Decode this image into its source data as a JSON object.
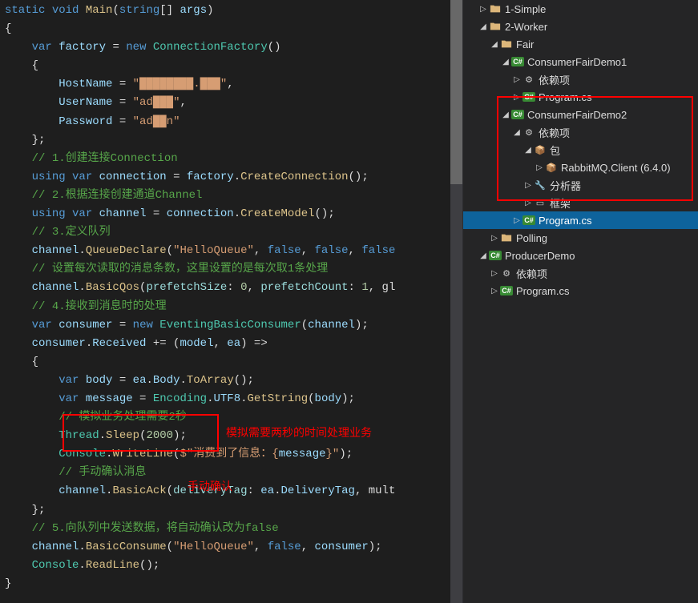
{
  "code": {
    "lines": [
      {
        "indent": 0,
        "segs": [
          {
            "c": "kw",
            "t": "static"
          },
          {
            "c": "",
            "t": " "
          },
          {
            "c": "kw",
            "t": "void"
          },
          {
            "c": "",
            "t": " "
          },
          {
            "c": "method",
            "t": "Main"
          },
          {
            "c": "",
            "t": "("
          },
          {
            "c": "kw",
            "t": "string"
          },
          {
            "c": "",
            "t": "[] "
          },
          {
            "c": "var",
            "t": "args"
          },
          {
            "c": "",
            "t": ")"
          }
        ]
      },
      {
        "indent": 0,
        "segs": [
          {
            "c": "",
            "t": "{"
          }
        ]
      },
      {
        "indent": 1,
        "segs": [
          {
            "c": "kw",
            "t": "var"
          },
          {
            "c": "",
            "t": " "
          },
          {
            "c": "var",
            "t": "factory"
          },
          {
            "c": "",
            "t": " = "
          },
          {
            "c": "kw",
            "t": "new"
          },
          {
            "c": "",
            "t": " "
          },
          {
            "c": "type",
            "t": "ConnectionFactory"
          },
          {
            "c": "",
            "t": "()"
          }
        ]
      },
      {
        "indent": 1,
        "segs": [
          {
            "c": "",
            "t": "{"
          }
        ]
      },
      {
        "indent": 2,
        "segs": [
          {
            "c": "var",
            "t": "HostName"
          },
          {
            "c": "",
            "t": " = "
          },
          {
            "c": "str",
            "t": "\"████████.███\""
          },
          {
            "c": "",
            "t": ","
          }
        ]
      },
      {
        "indent": 2,
        "segs": [
          {
            "c": "var",
            "t": "UserName"
          },
          {
            "c": "",
            "t": " = "
          },
          {
            "c": "str",
            "t": "\"ad███\""
          },
          {
            "c": "",
            "t": ","
          }
        ]
      },
      {
        "indent": 2,
        "segs": [
          {
            "c": "var",
            "t": "Password"
          },
          {
            "c": "",
            "t": " = "
          },
          {
            "c": "str",
            "t": "\"ad██n\""
          }
        ]
      },
      {
        "indent": 1,
        "segs": [
          {
            "c": "",
            "t": "};"
          }
        ]
      },
      {
        "indent": 1,
        "segs": [
          {
            "c": "com",
            "t": "// 1.创建连接Connection"
          }
        ]
      },
      {
        "indent": 1,
        "segs": [
          {
            "c": "kw",
            "t": "using"
          },
          {
            "c": "",
            "t": " "
          },
          {
            "c": "kw",
            "t": "var"
          },
          {
            "c": "",
            "t": " "
          },
          {
            "c": "var",
            "t": "connection"
          },
          {
            "c": "",
            "t": " = "
          },
          {
            "c": "var",
            "t": "factory"
          },
          {
            "c": "",
            "t": "."
          },
          {
            "c": "method",
            "t": "CreateConnection"
          },
          {
            "c": "",
            "t": "();"
          }
        ]
      },
      {
        "indent": 1,
        "segs": [
          {
            "c": "com",
            "t": "// 2.根据连接创建通道Channel"
          }
        ]
      },
      {
        "indent": 1,
        "segs": [
          {
            "c": "kw",
            "t": "using"
          },
          {
            "c": "",
            "t": " "
          },
          {
            "c": "kw",
            "t": "var"
          },
          {
            "c": "",
            "t": " "
          },
          {
            "c": "var",
            "t": "channel"
          },
          {
            "c": "",
            "t": " = "
          },
          {
            "c": "var",
            "t": "connection"
          },
          {
            "c": "",
            "t": "."
          },
          {
            "c": "method",
            "t": "CreateModel"
          },
          {
            "c": "",
            "t": "();"
          }
        ]
      },
      {
        "indent": 1,
        "segs": [
          {
            "c": "com",
            "t": "// 3.定义队列"
          }
        ]
      },
      {
        "indent": 1,
        "segs": [
          {
            "c": "var",
            "t": "channel"
          },
          {
            "c": "",
            "t": "."
          },
          {
            "c": "method",
            "t": "QueueDeclare"
          },
          {
            "c": "",
            "t": "("
          },
          {
            "c": "str",
            "t": "\"HelloQueue\""
          },
          {
            "c": "",
            "t": ", "
          },
          {
            "c": "kw",
            "t": "false"
          },
          {
            "c": "",
            "t": ", "
          },
          {
            "c": "kw",
            "t": "false"
          },
          {
            "c": "",
            "t": ", "
          },
          {
            "c": "kw",
            "t": "false"
          }
        ]
      },
      {
        "indent": 1,
        "segs": [
          {
            "c": "com",
            "t": "// 设置每次读取的消息条数，这里设置的是每次取1条处理"
          }
        ]
      },
      {
        "indent": 1,
        "segs": [
          {
            "c": "var",
            "t": "channel"
          },
          {
            "c": "",
            "t": "."
          },
          {
            "c": "method",
            "t": "BasicQos"
          },
          {
            "c": "",
            "t": "("
          },
          {
            "c": "param",
            "t": "prefetchSize"
          },
          {
            "c": "",
            "t": ": "
          },
          {
            "c": "num",
            "t": "0"
          },
          {
            "c": "",
            "t": ", "
          },
          {
            "c": "param",
            "t": "prefetchCount"
          },
          {
            "c": "",
            "t": ": "
          },
          {
            "c": "num",
            "t": "1"
          },
          {
            "c": "",
            "t": ", gl"
          }
        ]
      },
      {
        "indent": 1,
        "segs": [
          {
            "c": "com",
            "t": "// 4.接收到消息时的处理"
          }
        ]
      },
      {
        "indent": 1,
        "segs": [
          {
            "c": "kw",
            "t": "var"
          },
          {
            "c": "",
            "t": " "
          },
          {
            "c": "var",
            "t": "consumer"
          },
          {
            "c": "",
            "t": " = "
          },
          {
            "c": "kw",
            "t": "new"
          },
          {
            "c": "",
            "t": " "
          },
          {
            "c": "type",
            "t": "EventingBasicConsumer"
          },
          {
            "c": "",
            "t": "("
          },
          {
            "c": "var",
            "t": "channel"
          },
          {
            "c": "",
            "t": ");"
          }
        ]
      },
      {
        "indent": 1,
        "segs": [
          {
            "c": "var",
            "t": "consumer"
          },
          {
            "c": "",
            "t": "."
          },
          {
            "c": "var",
            "t": "Received"
          },
          {
            "c": "",
            "t": " += ("
          },
          {
            "c": "var",
            "t": "model"
          },
          {
            "c": "",
            "t": ", "
          },
          {
            "c": "var",
            "t": "ea"
          },
          {
            "c": "",
            "t": ") =>"
          }
        ]
      },
      {
        "indent": 1,
        "segs": [
          {
            "c": "",
            "t": "{"
          }
        ]
      },
      {
        "indent": 2,
        "segs": [
          {
            "c": "kw",
            "t": "var"
          },
          {
            "c": "",
            "t": " "
          },
          {
            "c": "var",
            "t": "body"
          },
          {
            "c": "",
            "t": " = "
          },
          {
            "c": "var",
            "t": "ea"
          },
          {
            "c": "",
            "t": "."
          },
          {
            "c": "var",
            "t": "Body"
          },
          {
            "c": "",
            "t": "."
          },
          {
            "c": "method",
            "t": "ToArray"
          },
          {
            "c": "",
            "t": "();"
          }
        ]
      },
      {
        "indent": 2,
        "segs": [
          {
            "c": "kw",
            "t": "var"
          },
          {
            "c": "",
            "t": " "
          },
          {
            "c": "var",
            "t": "message"
          },
          {
            "c": "",
            "t": " = "
          },
          {
            "c": "type",
            "t": "Encoding"
          },
          {
            "c": "",
            "t": "."
          },
          {
            "c": "var",
            "t": "UTF8"
          },
          {
            "c": "",
            "t": "."
          },
          {
            "c": "method",
            "t": "GetString"
          },
          {
            "c": "",
            "t": "("
          },
          {
            "c": "var",
            "t": "body"
          },
          {
            "c": "",
            "t": ");"
          }
        ]
      },
      {
        "indent": 2,
        "segs": [
          {
            "c": "com",
            "t": "// 模拟业务处理需要2秒"
          }
        ]
      },
      {
        "indent": 2,
        "segs": [
          {
            "c": "type",
            "t": "Thread"
          },
          {
            "c": "",
            "t": "."
          },
          {
            "c": "method",
            "t": "Sleep"
          },
          {
            "c": "",
            "t": "("
          },
          {
            "c": "num",
            "t": "2000"
          },
          {
            "c": "",
            "t": ");"
          }
        ]
      },
      {
        "indent": 2,
        "segs": [
          {
            "c": "type",
            "t": "Console"
          },
          {
            "c": "",
            "t": "."
          },
          {
            "c": "method",
            "t": "WriteLine"
          },
          {
            "c": "",
            "t": "("
          },
          {
            "c": "str",
            "t": "$\"消费到了信息：{"
          },
          {
            "c": "var",
            "t": "message"
          },
          {
            "c": "str",
            "t": "}\""
          },
          {
            "c": "",
            "t": ");"
          }
        ]
      },
      {
        "indent": 2,
        "segs": [
          {
            "c": "com",
            "t": "// 手动确认消息"
          }
        ]
      },
      {
        "indent": 2,
        "segs": [
          {
            "c": "var",
            "t": "channel"
          },
          {
            "c": "",
            "t": "."
          },
          {
            "c": "method",
            "t": "BasicAck"
          },
          {
            "c": "",
            "t": "("
          },
          {
            "c": "param",
            "t": "deliveryTag"
          },
          {
            "c": "",
            "t": ": "
          },
          {
            "c": "var",
            "t": "ea"
          },
          {
            "c": "",
            "t": "."
          },
          {
            "c": "var",
            "t": "DeliveryTag"
          },
          {
            "c": "",
            "t": ", mult"
          }
        ]
      },
      {
        "indent": 1,
        "segs": [
          {
            "c": "",
            "t": "};"
          }
        ]
      },
      {
        "indent": 1,
        "segs": [
          {
            "c": "com",
            "t": "// 5.向队列中发送数据，将自动确认改为false"
          }
        ]
      },
      {
        "indent": 1,
        "segs": [
          {
            "c": "var",
            "t": "channel"
          },
          {
            "c": "",
            "t": "."
          },
          {
            "c": "method",
            "t": "BasicConsume"
          },
          {
            "c": "",
            "t": "("
          },
          {
            "c": "str",
            "t": "\"HelloQueue\""
          },
          {
            "c": "",
            "t": ", "
          },
          {
            "c": "kw",
            "t": "false"
          },
          {
            "c": "",
            "t": ", "
          },
          {
            "c": "var",
            "t": "consumer"
          },
          {
            "c": "",
            "t": ");"
          }
        ]
      },
      {
        "indent": 1,
        "segs": [
          {
            "c": "type",
            "t": "Console"
          },
          {
            "c": "",
            "t": "."
          },
          {
            "c": "method",
            "t": "ReadLine"
          },
          {
            "c": "",
            "t": "();"
          }
        ]
      },
      {
        "indent": 0,
        "segs": [
          {
            "c": "",
            "t": "}"
          }
        ]
      }
    ]
  },
  "annotations": {
    "sim": "模拟需要两秒的时间处理业务",
    "ack": "手动确认"
  },
  "tree": [
    {
      "depth": 1,
      "exp": "▷",
      "icon": "folder",
      "iconClass": "folder",
      "label": "1-Simple"
    },
    {
      "depth": 1,
      "exp": "◢",
      "icon": "folder",
      "iconClass": "folder",
      "label": "2-Worker"
    },
    {
      "depth": 2,
      "exp": "◢",
      "icon": "folder",
      "iconClass": "folder",
      "label": "Fair"
    },
    {
      "depth": 3,
      "exp": "◢",
      "icon": "C#",
      "iconClass": "csfolder",
      "label": "ConsumerFairDemo1"
    },
    {
      "depth": 4,
      "exp": "▷",
      "icon": "⚙",
      "iconClass": "gear",
      "label": "依赖项"
    },
    {
      "depth": 4,
      "exp": "▷",
      "icon": "C#",
      "iconClass": "csfile",
      "label": "Program.cs"
    },
    {
      "depth": 3,
      "exp": "◢",
      "icon": "C#",
      "iconClass": "csfolder",
      "label": "ConsumerFairDemo2"
    },
    {
      "depth": 4,
      "exp": "◢",
      "icon": "⚙",
      "iconClass": "gear",
      "label": "依赖项"
    },
    {
      "depth": 5,
      "exp": "◢",
      "icon": "📦",
      "iconClass": "package",
      "label": "包"
    },
    {
      "depth": 6,
      "exp": "▷",
      "icon": "📦",
      "iconClass": "package",
      "label": "RabbitMQ.Client (6.4.0)"
    },
    {
      "depth": 5,
      "exp": "▷",
      "icon": "🔧",
      "iconClass": "wrench",
      "label": "分析器"
    },
    {
      "depth": 5,
      "exp": "▷",
      "icon": "▭",
      "iconClass": "frame",
      "label": "框架"
    },
    {
      "depth": 4,
      "exp": "▷",
      "icon": "C#",
      "iconClass": "csfile",
      "label": "Program.cs",
      "selected": true
    },
    {
      "depth": 2,
      "exp": "▷",
      "icon": "folder",
      "iconClass": "folder",
      "label": "Polling"
    },
    {
      "depth": 1,
      "exp": "◢",
      "icon": "C#",
      "iconClass": "csfolder",
      "label": "ProducerDemo"
    },
    {
      "depth": 2,
      "exp": "▷",
      "icon": "⚙",
      "iconClass": "gear",
      "label": "依赖项"
    },
    {
      "depth": 2,
      "exp": "▷",
      "icon": "C#",
      "iconClass": "csfile",
      "label": "Program.cs"
    }
  ]
}
